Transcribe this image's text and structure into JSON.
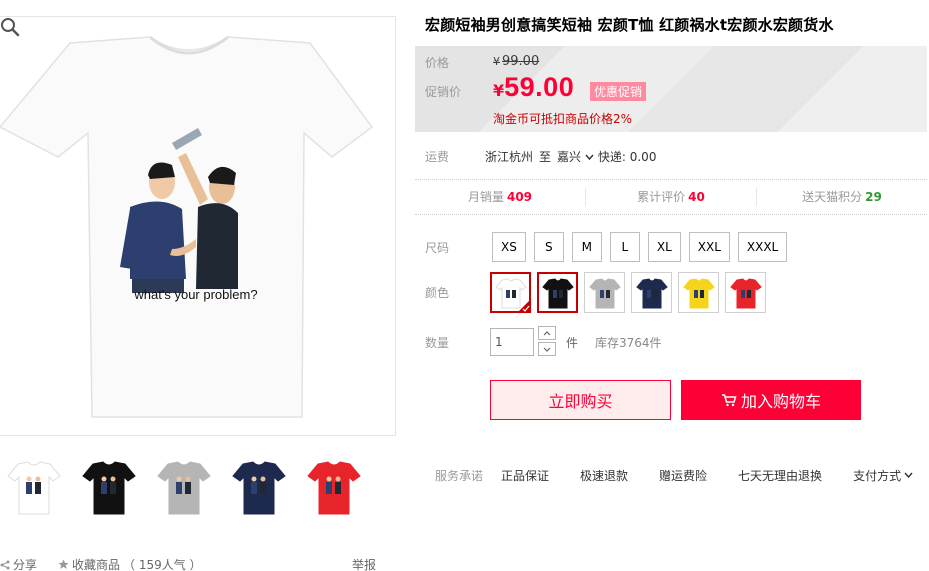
{
  "product": {
    "title": "宏颜短袖男创意搞笑短袖 宏颜T恤 红颜祸水t宏颜水宏颜货水",
    "shirt_caption": "what's your problem?"
  },
  "price": {
    "label_price": "价格",
    "label_promo": "促销价",
    "currency": "¥",
    "original": "99.00",
    "promo": "59.00",
    "promo_badge": "优惠促销",
    "taojin_note": "淘金币可抵扣商品价格2%"
  },
  "shipping": {
    "label": "运费",
    "from": "浙江杭州",
    "to": "至",
    "destination": "嘉兴",
    "fee": "快递: 0.00"
  },
  "stats": [
    {
      "label": "月销量",
      "value": "409",
      "color": "#ff0036"
    },
    {
      "label": "累计评价",
      "value": "40",
      "color": "#ff0036"
    },
    {
      "label": "送天猫积分",
      "value": "29",
      "color": "#339933"
    }
  ],
  "size": {
    "label": "尺码",
    "options": [
      "XS",
      "S",
      "M",
      "L",
      "XL",
      "XXL",
      "XXXL"
    ]
  },
  "color": {
    "label": "颜色",
    "selected_index": 0,
    "options": [
      {
        "name": "white",
        "hex": "#ffffff"
      },
      {
        "name": "black",
        "hex": "#111111"
      },
      {
        "name": "gray",
        "hex": "#b5b5b5"
      },
      {
        "name": "navy",
        "hex": "#1d2a4d"
      },
      {
        "name": "yellow",
        "hex": "#f7d41c"
      },
      {
        "name": "red",
        "hex": "#e8242b"
      }
    ]
  },
  "quantity": {
    "label": "数量",
    "value": "1",
    "unit": "件",
    "stock": "库存3764件"
  },
  "actions": {
    "buy_now": "立即购买",
    "add_to_cart": "加入购物车"
  },
  "services": {
    "label": "服务承诺",
    "items": [
      "正品保证",
      "极速退款",
      "赠运费险",
      "七天无理由退换"
    ],
    "pay": "支付方式"
  },
  "gallery": {
    "thumbs": [
      {
        "name": "white",
        "hex": "#ffffff"
      },
      {
        "name": "black",
        "hex": "#111111"
      },
      {
        "name": "gray",
        "hex": "#b5b5b5"
      },
      {
        "name": "navy",
        "hex": "#1d2a4d"
      },
      {
        "name": "red",
        "hex": "#e8242b"
      }
    ]
  },
  "footer": {
    "share": "分享",
    "favorite": "收藏商品",
    "popularity": "（ 159人气 ）",
    "report": "举报"
  },
  "colors": {
    "accent": "#ff0036",
    "accent_light": "#ffeded"
  }
}
